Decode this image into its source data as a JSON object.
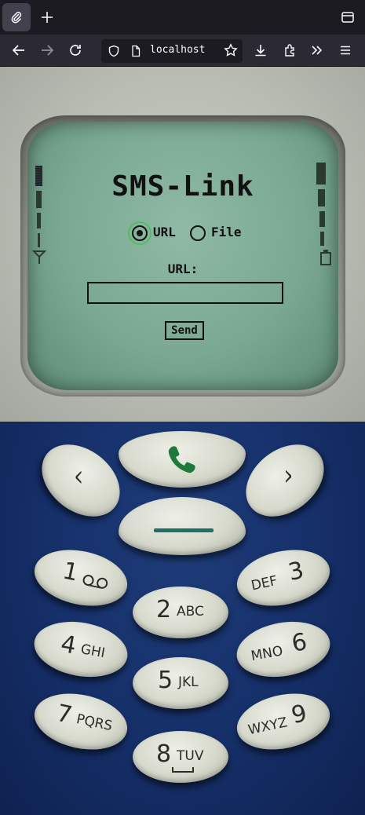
{
  "browser": {
    "url": "localhost"
  },
  "app": {
    "title": "SMS-Link",
    "radio_url_label": "URL",
    "radio_file_label": "File",
    "selected": "URL",
    "url_field_label": "URL:",
    "url_value": "",
    "send_label": "Send"
  },
  "keypad": {
    "keys": [
      {
        "num": "1",
        "letters": "ꝏ"
      },
      {
        "num": "2",
        "letters": "ABC"
      },
      {
        "num": "3",
        "letters": "DEF"
      },
      {
        "num": "4",
        "letters": "GHI"
      },
      {
        "num": "5",
        "letters": "JKL"
      },
      {
        "num": "6",
        "letters": "MNO"
      },
      {
        "num": "7",
        "letters": "PQRS"
      },
      {
        "num": "8",
        "letters": "TUV"
      },
      {
        "num": "9",
        "letters": "WXYZ"
      }
    ]
  },
  "colors": {
    "call_icon": "#1f7a3a",
    "hangup_bar": "#1f6f6a",
    "radio_focus": "#4fbf62"
  }
}
